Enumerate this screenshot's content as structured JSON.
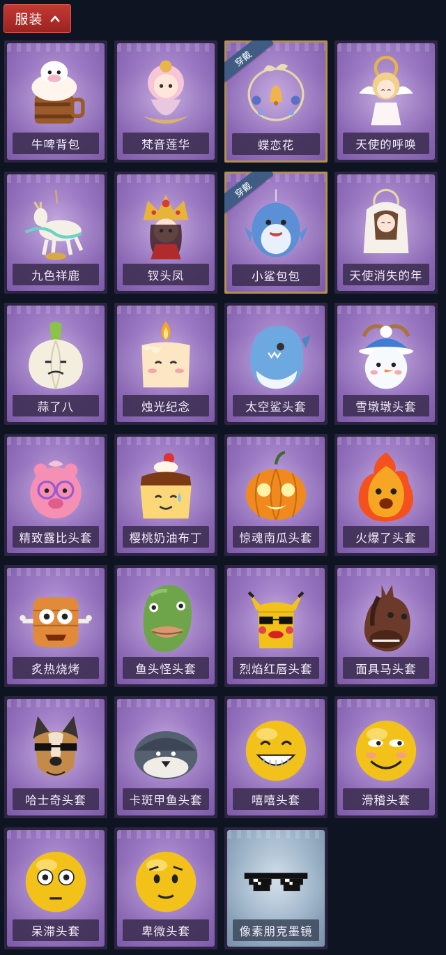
{
  "header": {
    "label": "服装"
  },
  "equipped_badge": "穿戴",
  "items": [
    {
      "name": "牛啤背包",
      "icon": "cow-beer-backpack-icon",
      "equipped": false
    },
    {
      "name": "梵音莲华",
      "icon": "lotus-spirit-icon",
      "equipped": false
    },
    {
      "name": "蝶恋花",
      "icon": "butterfly-bell-icon",
      "equipped": true
    },
    {
      "name": "天使的呼唤",
      "icon": "angel-doll-icon",
      "equipped": false
    },
    {
      "name": "九色祥鹿",
      "icon": "deer-icon",
      "equipped": false
    },
    {
      "name": "钗头凤",
      "icon": "phoenix-crown-icon",
      "equipped": false
    },
    {
      "name": "小鲨包包",
      "icon": "shark-bag-icon",
      "equipped": true
    },
    {
      "name": "天使消失的年",
      "icon": "veiled-angel-icon",
      "equipped": false
    },
    {
      "name": "蒜了八",
      "icon": "garlic-head-icon",
      "equipped": false
    },
    {
      "name": "烛光纪念",
      "icon": "candle-head-icon",
      "equipped": false
    },
    {
      "name": "太空鲨头套",
      "icon": "space-shark-head-icon",
      "equipped": false
    },
    {
      "name": "雪墩墩头套",
      "icon": "snowman-head-icon",
      "equipped": false
    },
    {
      "name": "精致露比头套",
      "icon": "loopy-head-icon",
      "equipped": false
    },
    {
      "name": "樱桃奶油布丁",
      "icon": "pudding-head-icon",
      "equipped": false
    },
    {
      "name": "惊魂南瓜头套",
      "icon": "pumpkin-head-icon",
      "equipped": false
    },
    {
      "name": "火爆了头套",
      "icon": "fire-head-icon",
      "equipped": false
    },
    {
      "name": "炙热烧烤",
      "icon": "bbq-head-icon",
      "equipped": false
    },
    {
      "name": "鱼头怪头套",
      "icon": "fish-head-icon",
      "equipped": false
    },
    {
      "name": "烈焰红唇头套",
      "icon": "pikachu-lips-head-icon",
      "equipped": false
    },
    {
      "name": "面具马头套",
      "icon": "horse-head-icon",
      "equipped": false
    },
    {
      "name": "哈士奇头套",
      "icon": "husky-head-icon",
      "equipped": false
    },
    {
      "name": "卡斑甲鱼头套",
      "icon": "turtle-head-icon",
      "equipped": false
    },
    {
      "name": "嘻嘻头套",
      "icon": "grin-emoji-head-icon",
      "equipped": false
    },
    {
      "name": "滑稽头套",
      "icon": "funny-emoji-head-icon",
      "equipped": false
    },
    {
      "name": "呆滞头套",
      "icon": "dazed-emoji-head-icon",
      "equipped": false
    },
    {
      "name": "卑微头套",
      "icon": "humble-emoji-head-icon",
      "equipped": false
    },
    {
      "name": "像素朋克墨镜",
      "icon": "pixel-sunglasses-icon",
      "equipped": false
    }
  ],
  "colors": {
    "background": "#0e1422",
    "header_red": "#b02c28",
    "card_purple": "#9a78c2",
    "equipped_gold": "#b09050",
    "ribbon_blue": "#3f5d84"
  }
}
